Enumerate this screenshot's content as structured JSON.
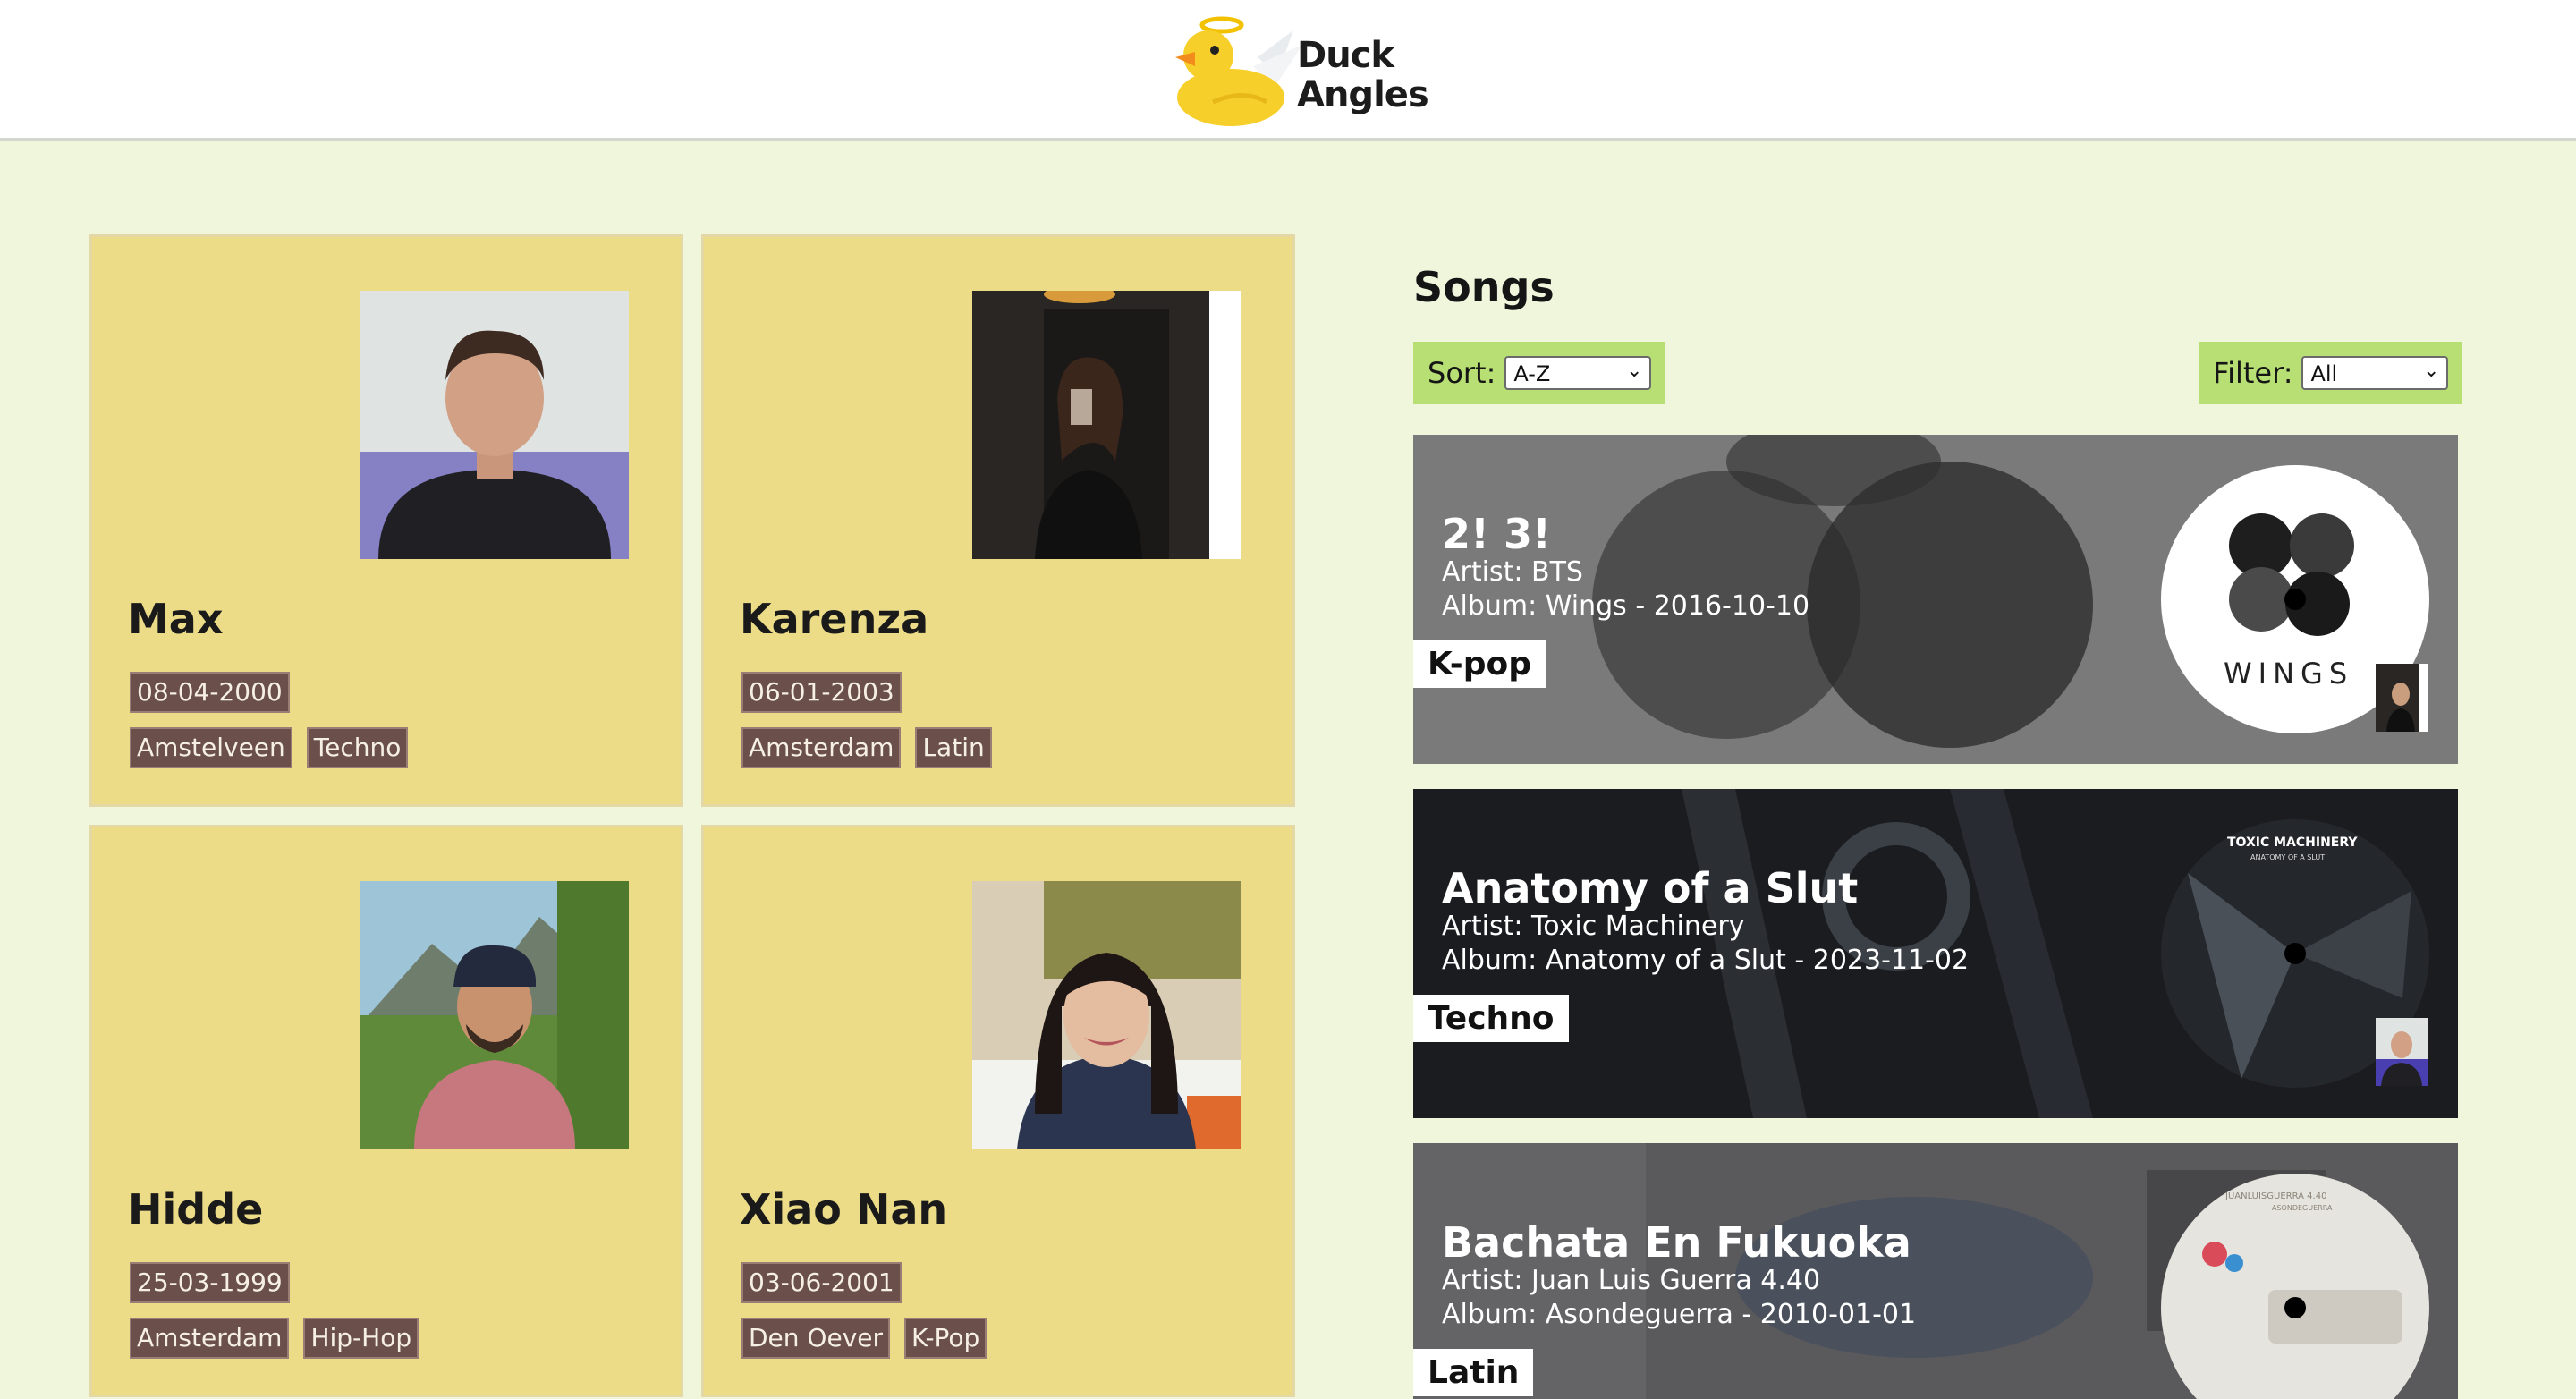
{
  "header": {
    "logo_icon": "duck-angel-logo",
    "brand_line1": "Duck",
    "brand_line2": "Angles"
  },
  "people": [
    {
      "name": "Max",
      "birthdate": "08-04-2000",
      "city": "Amstelveen",
      "genre": "Techno",
      "photo_icon": "person-photo"
    },
    {
      "name": "Karenza",
      "birthdate": "06-01-2003",
      "city": "Amsterdam",
      "genre": "Latin",
      "photo_icon": "person-photo"
    },
    {
      "name": "Hidde",
      "birthdate": "25-03-1999",
      "city": "Amsterdam",
      "genre": "Hip-Hop",
      "photo_icon": "person-photo"
    },
    {
      "name": "Xiao Nan",
      "birthdate": "03-06-2001",
      "city": "Den Oever",
      "genre": "K-Pop",
      "photo_icon": "person-photo"
    }
  ],
  "songs_panel": {
    "title": "Songs",
    "sort_label": "Sort:",
    "sort_value": "A-Z",
    "filter_label": "Filter:",
    "filter_value": "All"
  },
  "songs": [
    {
      "title": "2! 3!",
      "artist": "Artist: BTS",
      "album": "Album: Wings - 2016-10-10",
      "genre": "K-pop",
      "cover_text": "WINGS",
      "bg_color": "#7a7a7a"
    },
    {
      "title": "Anatomy of a Slut",
      "artist": "Artist: Toxic Machinery",
      "album": "Album: Anatomy of a Slut - 2023-11-02",
      "genre": "Techno",
      "cover_text": "TOXIC MACHINERY",
      "cover_subtext": "ANATOMY OF A SLUT",
      "bg_color": "#1a1c20"
    },
    {
      "title": "Bachata En Fukuoka",
      "artist": "Artist: Juan Luis Guerra 4.40",
      "album": "Album: Asondeguerra - 2010-01-01",
      "genre": "Latin",
      "cover_text": "JUANLUISGUERRA 4.40",
      "cover_subtext": "ASONDEGUERRA",
      "bg_color": "#5a5a5c"
    }
  ],
  "colors": {
    "page_bg": "#eff6dc",
    "card_bg": "#ecdc88",
    "chip_bg": "#6a4f4a",
    "control_bg": "#b7df74"
  }
}
